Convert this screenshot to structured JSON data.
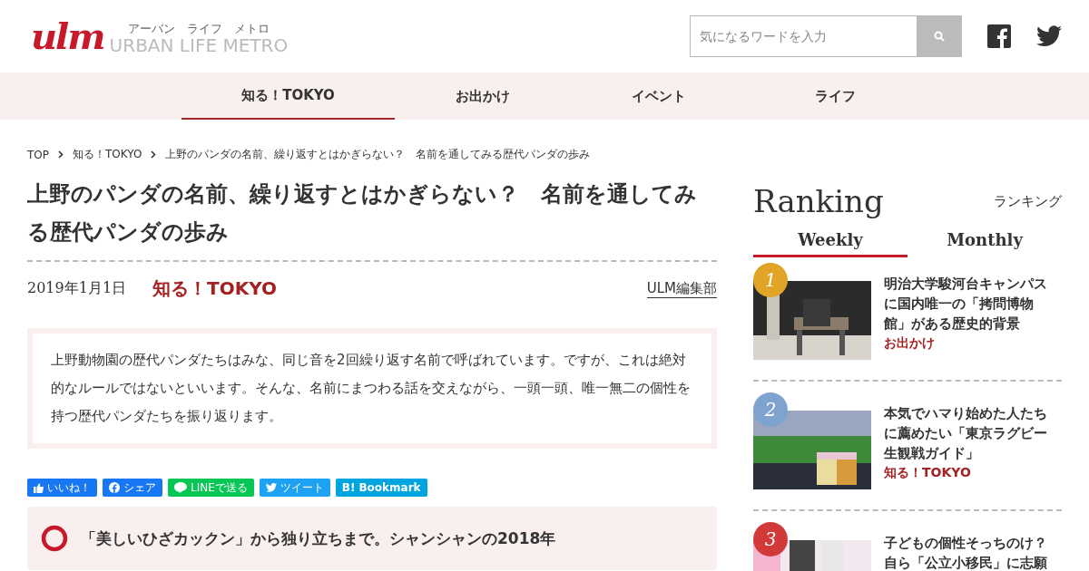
{
  "logo": {
    "mark": "ulm",
    "name": "URBAN LIFE METRO",
    "reading": "アーバン　ライフ　メトロ"
  },
  "search": {
    "placeholder": "気になるワードを入力"
  },
  "nav": [
    {
      "label": "知る！TOKYO",
      "selected": true
    },
    {
      "label": "お出かけ",
      "selected": false
    },
    {
      "label": "イベント",
      "selected": false
    },
    {
      "label": "ライフ",
      "selected": false
    }
  ],
  "breadcrumb": [
    "TOP",
    "知る！TOKYO",
    "上野のパンダの名前、繰り返すとはかぎらない？　名前を通してみる歴代パンダの歩み"
  ],
  "article": {
    "title": "上野のパンダの名前、繰り返すとはかぎらない？　名前を通してみる歴代パンダの歩み",
    "date": "2019年1月1日",
    "category": "知る！TOKYO",
    "author": "ULM編集部",
    "lead": "上野動物園の歴代パンダたちはみな、同じ音を2回繰り返す名前で呼ばれています。ですが、これは絶対的なルールではないといいます。そんな、名前にまつわる話を交えながら、一頭一頭、唯一無二の個性を持つ歴代パンダたちを振り返ります。",
    "share": [
      {
        "kind": "like",
        "label": "いいね！"
      },
      {
        "kind": "facebook",
        "label": "シェア"
      },
      {
        "kind": "line",
        "label": "LINEで送る"
      },
      {
        "kind": "twitter",
        "label": "ツイート"
      },
      {
        "kind": "hatena",
        "mark": "B!",
        "label": "Bookmark"
      }
    ],
    "section_heading": "「美しいひざカックン」から独り立ちまで。シャンシャンの2018年"
  },
  "ranking": {
    "title": "Ranking",
    "subtitle": "ランキング",
    "tabs": [
      {
        "label": "Weekly",
        "selected": true
      },
      {
        "label": "Monthly",
        "selected": false
      }
    ],
    "items": [
      {
        "rank": "1",
        "color": "#e0a526",
        "title": "明治大学駿河台キャンパスに国内唯一の「拷問博物館」がある歴史的背景",
        "category": "お出かけ"
      },
      {
        "rank": "2",
        "color": "#7fa3cf",
        "title": "本気でハマり始めた人たちに薦めたい「東京ラグビー生観戦ガイド」",
        "category": "知る！TOKYO"
      },
      {
        "rank": "3",
        "color": "#d23a3a",
        "title": "子どもの個性そっちのけ？自ら「公立小移民」に志願"
      }
    ]
  }
}
